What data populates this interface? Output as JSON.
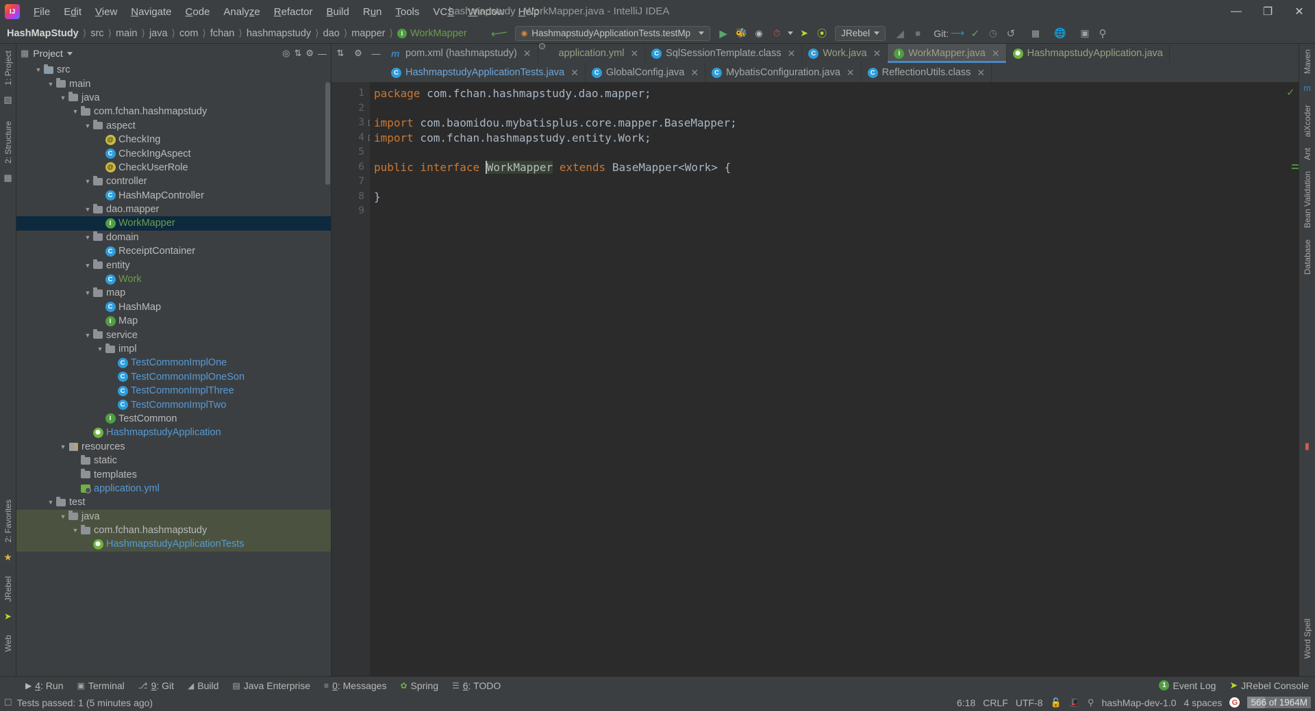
{
  "window": {
    "title": "hashmapstudy - WorkMapper.java - IntelliJ IDEA",
    "logo": "intellij-idea-logo",
    "minimize": "—",
    "maximize": "❐",
    "close": "✕"
  },
  "menu": [
    {
      "label": "File"
    },
    {
      "label": "Edit"
    },
    {
      "label": "View"
    },
    {
      "label": "Navigate"
    },
    {
      "label": "Code"
    },
    {
      "label": "Analyze"
    },
    {
      "label": "Refactor"
    },
    {
      "label": "Build"
    },
    {
      "label": "Run"
    },
    {
      "label": "Tools"
    },
    {
      "label": "VCS"
    },
    {
      "label": "Window"
    },
    {
      "label": "Help"
    }
  ],
  "breadcrumbs": [
    {
      "label": "HashMapStudy"
    },
    {
      "label": "src"
    },
    {
      "label": "main"
    },
    {
      "label": "java"
    },
    {
      "label": "com"
    },
    {
      "label": "fchan"
    },
    {
      "label": "hashmapstudy"
    },
    {
      "label": "dao"
    },
    {
      "label": "mapper"
    },
    {
      "label": "WorkMapper"
    }
  ],
  "toolbar": {
    "run_config": "HashmapstudyApplicationTests.testMp",
    "run_icon": "run-icon",
    "debug_icon": "debug-icon",
    "run_coverage_icon": "run-with-coverage-icon",
    "profiler_icon": "profiler-icon",
    "jrebel_run_icon": "jrebel-run-icon",
    "jrebel_debug_icon": "jrebel-debug-icon",
    "jrebel_label": "JRebel",
    "stop_icon": "stop-icon",
    "hammer_icon": "build-icon",
    "git_label": "Git:",
    "git_update_icon": "update-project-icon",
    "git_commit_icon": "commit-icon",
    "git_history_icon": "history-icon",
    "git_rollback_icon": "rollback-icon",
    "structure_icon": "structure-icon",
    "translate_icon": "google-translate-icon",
    "present_icon": "presentation-icon",
    "search_icon": "search-everywhere-icon",
    "back_icon": "back-arrow-icon"
  },
  "project_panel": {
    "title": "Project",
    "locate_icon": "locate-file-icon",
    "collapse_icon": "collapse-all-icon",
    "settings_icon": "gear-icon",
    "hide_icon": "hide-icon",
    "tree": [
      {
        "label": "src",
        "indent": 1,
        "icon": "folder-src",
        "arrow": "▼",
        "color": "plain"
      },
      {
        "label": "main",
        "indent": 2,
        "icon": "folder",
        "arrow": "▼",
        "color": "plain"
      },
      {
        "label": "java",
        "indent": 3,
        "icon": "folder",
        "arrow": "▼",
        "color": "plain"
      },
      {
        "label": "com.fchan.hashmapstudy",
        "indent": 4,
        "icon": "folder",
        "arrow": "▼",
        "color": "plain"
      },
      {
        "label": "aspect",
        "indent": 5,
        "icon": "folder",
        "arrow": "▼",
        "color": "plain"
      },
      {
        "label": "CheckIng",
        "indent": 6,
        "icon": "annotation",
        "arrow": "",
        "color": "plain"
      },
      {
        "label": "CheckIngAspect",
        "indent": 6,
        "icon": "class",
        "arrow": "",
        "color": "plain"
      },
      {
        "label": "CheckUserRole",
        "indent": 6,
        "icon": "annotation",
        "arrow": "",
        "color": "plain"
      },
      {
        "label": "controller",
        "indent": 5,
        "icon": "folder",
        "arrow": "▼",
        "color": "plain"
      },
      {
        "label": "HashMapController",
        "indent": 6,
        "icon": "class",
        "arrow": "",
        "color": "plain"
      },
      {
        "label": "dao.mapper",
        "indent": 5,
        "icon": "folder",
        "arrow": "▼",
        "color": "plain"
      },
      {
        "label": "WorkMapper",
        "indent": 6,
        "icon": "interface",
        "arrow": "",
        "color": "green",
        "selected": true
      },
      {
        "label": "domain",
        "indent": 5,
        "icon": "folder",
        "arrow": "▼",
        "color": "plain"
      },
      {
        "label": "ReceiptContainer",
        "indent": 6,
        "icon": "class",
        "arrow": "",
        "color": "plain"
      },
      {
        "label": "entity",
        "indent": 5,
        "icon": "folder",
        "arrow": "▼",
        "color": "plain"
      },
      {
        "label": "Work",
        "indent": 6,
        "icon": "class",
        "arrow": "",
        "color": "green"
      },
      {
        "label": "map",
        "indent": 5,
        "icon": "folder",
        "arrow": "▼",
        "color": "plain"
      },
      {
        "label": "HashMap",
        "indent": 6,
        "icon": "class",
        "arrow": "",
        "color": "plain"
      },
      {
        "label": "Map",
        "indent": 6,
        "icon": "interface",
        "arrow": "",
        "color": "plain"
      },
      {
        "label": "service",
        "indent": 5,
        "icon": "folder",
        "arrow": "▼",
        "color": "plain"
      },
      {
        "label": "impl",
        "indent": 6,
        "icon": "folder",
        "arrow": "▼",
        "color": "plain"
      },
      {
        "label": "TestCommonImplOne",
        "indent": 7,
        "icon": "class",
        "arrow": "",
        "color": "blue"
      },
      {
        "label": "TestCommonImplOneSon",
        "indent": 7,
        "icon": "class",
        "arrow": "",
        "color": "blue"
      },
      {
        "label": "TestCommonImplThree",
        "indent": 7,
        "icon": "class",
        "arrow": "",
        "color": "blue"
      },
      {
        "label": "TestCommonImplTwo",
        "indent": 7,
        "icon": "class",
        "arrow": "",
        "color": "blue"
      },
      {
        "label": "TestCommon",
        "indent": 6,
        "icon": "interface",
        "arrow": "",
        "color": "plain"
      },
      {
        "label": "HashmapstudyApplication",
        "indent": 5,
        "icon": "spring",
        "arrow": "",
        "color": "blue"
      },
      {
        "label": "resources",
        "indent": 3,
        "icon": "resources",
        "arrow": "▼",
        "color": "plain"
      },
      {
        "label": "static",
        "indent": 4,
        "icon": "folder",
        "arrow": "",
        "color": "plain"
      },
      {
        "label": "templates",
        "indent": 4,
        "icon": "folder",
        "arrow": "",
        "color": "plain"
      },
      {
        "label": "application.yml",
        "indent": 4,
        "icon": "yml",
        "arrow": "",
        "color": "blue"
      },
      {
        "label": "test",
        "indent": 2,
        "icon": "folder",
        "arrow": "▼",
        "color": "plain"
      },
      {
        "label": "java",
        "indent": 3,
        "icon": "folder",
        "arrow": "▼",
        "color": "plain",
        "green_row": true
      },
      {
        "label": "com.fchan.hashmapstudy",
        "indent": 4,
        "icon": "folder",
        "arrow": "▼",
        "color": "plain",
        "green_row": true
      },
      {
        "label": "HashmapstudyApplicationTests",
        "indent": 5,
        "icon": "spring",
        "arrow": "",
        "color": "blue",
        "green_row": true
      }
    ]
  },
  "left_rail": [
    {
      "label": "1: Project"
    },
    {
      "label": "2: Structure"
    },
    {
      "label": "2: Favorites"
    },
    {
      "label": "JRebel"
    },
    {
      "label": "Web"
    }
  ],
  "right_rail": [
    {
      "label": "Maven"
    },
    {
      "label": "aiXcoder"
    },
    {
      "label": "Ant"
    },
    {
      "label": "Bean Validation"
    },
    {
      "label": "Database"
    },
    {
      "label": "Word Spell"
    }
  ],
  "editor_tabs_row1": [
    {
      "label": "pom.xml (hashmapstudy)",
      "icon": "maven-icon",
      "color": "grey",
      "closable": true
    },
    {
      "label": "application.yml",
      "icon": "yml-icon",
      "color": "green",
      "closable": true
    },
    {
      "label": "SqlSessionTemplate.class",
      "icon": "class-locked-icon",
      "color": "grey",
      "closable": true
    },
    {
      "label": "Work.java",
      "icon": "class-icon",
      "color": "green",
      "closable": true
    },
    {
      "label": "WorkMapper.java",
      "icon": "interface-icon",
      "color": "green",
      "closable": true,
      "active": true
    },
    {
      "label": "HashmapstudyApplication.java",
      "icon": "spring-icon",
      "color": "green",
      "closable": false
    }
  ],
  "editor_tabs_row2": [
    {
      "label": "HashmapstudyApplicationTests.java",
      "icon": "class-icon",
      "color": "blue",
      "closable": true
    },
    {
      "label": "GlobalConfig.java",
      "icon": "class-locked-icon",
      "color": "grey",
      "closable": true
    },
    {
      "label": "MybatisConfiguration.java",
      "icon": "class-locked-icon",
      "color": "grey",
      "closable": true
    },
    {
      "label": "ReflectionUtils.class",
      "icon": "class-locked-icon",
      "color": "grey",
      "closable": true
    }
  ],
  "code": {
    "line_numbers": [
      "1",
      "2",
      "3",
      "4",
      "5",
      "6",
      "7",
      "8",
      "9"
    ],
    "lines": [
      {
        "n": 1,
        "tokens": [
          {
            "t": "package",
            "c": "kw"
          },
          {
            "t": " com.fchan.hashmapstudy.dao.mapper;",
            "c": "pl"
          }
        ]
      },
      {
        "n": 2,
        "tokens": []
      },
      {
        "n": 3,
        "fold": "-",
        "tokens": [
          {
            "t": "import",
            "c": "kw"
          },
          {
            "t": " com.baomidou.mybatisplus.core.mapper.BaseMapper;",
            "c": "pl"
          }
        ]
      },
      {
        "n": 4,
        "fold": "┐",
        "tokens": [
          {
            "t": "import",
            "c": "kw"
          },
          {
            "t": " com.fchan.hashmapstudy.entity.Work;",
            "c": "pl"
          }
        ]
      },
      {
        "n": 5,
        "tokens": []
      },
      {
        "n": 6,
        "tokens": [
          {
            "t": "public",
            "c": "kw"
          },
          {
            "t": " ",
            "c": "pl"
          },
          {
            "t": "interface",
            "c": "kw"
          },
          {
            "t": " ",
            "c": "pl"
          },
          {
            "t": "WorkMapper",
            "c": "hl"
          },
          {
            "t": " ",
            "c": "pl"
          },
          {
            "t": "extends",
            "c": "kw"
          },
          {
            "t": " BaseMapper<Work> {",
            "c": "pl"
          }
        ]
      },
      {
        "n": 7,
        "tokens": []
      },
      {
        "n": 8,
        "tokens": [
          {
            "t": "}",
            "c": "pl"
          }
        ]
      },
      {
        "n": 9,
        "tokens": []
      }
    ],
    "inspection_status": "✓"
  },
  "tool_windows": [
    {
      "num": "4",
      "label": ": Run",
      "icon": "run-icon"
    },
    {
      "num": "",
      "label": "Terminal",
      "icon": "terminal-icon"
    },
    {
      "num": "9",
      "label": ": Git",
      "icon": "git-icon"
    },
    {
      "num": "",
      "label": "Build",
      "icon": "build-icon"
    },
    {
      "num": "",
      "label": "Java Enterprise",
      "icon": "java-enterprise-icon"
    },
    {
      "num": "0",
      "label": ": Messages",
      "icon": "messages-icon"
    },
    {
      "num": "",
      "label": "Spring",
      "icon": "spring-icon"
    },
    {
      "num": "6",
      "label": ": TODO",
      "icon": "todo-icon"
    }
  ],
  "tool_windows_right": [
    {
      "label": "Event Log",
      "badge": "1",
      "icon": "event-log-icon"
    },
    {
      "label": "JRebel Console",
      "icon": "jrebel-icon"
    }
  ],
  "statusbar": {
    "message": "Tests passed: 1 (5 minutes ago)",
    "message_icon": "notification-icon",
    "caret_position": "6:18",
    "line_separator": "CRLF",
    "encoding": "UTF-8",
    "lock_icon": "read-only-lock-icon",
    "inspection_icon": "inspection-hat-icon",
    "branch_icon": "git-branch-icon",
    "branch": "hashMap-dev-1.0",
    "indent": "4 spaces",
    "translate_icon": "google-icon",
    "memory": "566 of 1964M"
  },
  "colors": {
    "accent": "#4a88c7",
    "selection": "#0d293e",
    "green_text": "#6a9c4f",
    "keyword": "#cc7832",
    "plain": "#a9b7c6",
    "editor_bg": "#2b2b2b",
    "panel_bg": "#3c3f41"
  }
}
